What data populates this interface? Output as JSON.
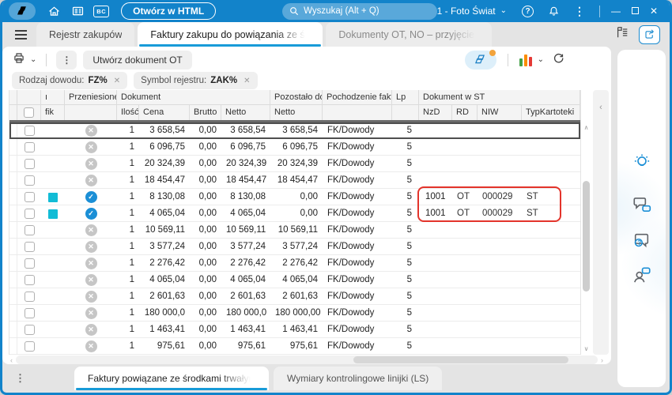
{
  "colors": {
    "titlebar": "#1283CA",
    "accent": "#189BD8",
    "transferred_blue": "#1B8FD6",
    "flag_teal": "#12BCD6",
    "annotation_red": "#E3342B"
  },
  "icons": {
    "bc_badge": "BC",
    "kebab": "⋮",
    "chevron_down": "⌄",
    "question": "?",
    "minimize": "—",
    "close": "✕",
    "check": "✓",
    "cross": "✕",
    "chip_close": "✕",
    "collapse_left": "‹",
    "scroll_left": "‹",
    "scroll_right": "›",
    "scroll_up": "∧",
    "scroll_down": "∨"
  },
  "titlebar": {
    "open_html_button": "Otwórz w HTML",
    "search_placeholder": "Wyszukaj (Alt + Q)",
    "company": "1 - Foto Świat"
  },
  "tabs": [
    {
      "label": "Rejestr zakupów",
      "active": false
    },
    {
      "label": "Faktury zakupu do powiązania ze środkami trwałymi",
      "active": true
    },
    {
      "label": "Dokumenty OT, NO – przyjęcie środka",
      "active": false
    }
  ],
  "toolbar": {
    "create_ot_button": "Utwórz dokument OT"
  },
  "filters": [
    {
      "name": "Rodzaj dowodu:",
      "value": "FZ%"
    },
    {
      "name": "Symbol rejestru:",
      "value": "ZAK%"
    }
  ],
  "table": {
    "header": {
      "clipped_line1": "ı",
      "clipped_line2": "fik",
      "przeniesione": "Przeniesione",
      "dokument": "Dokument",
      "ilosc": "Ilość",
      "cena": "Cena",
      "brutto": "Brutto",
      "netto": "Netto",
      "pozostalo": "Pozostało do",
      "pozostalo_netto": "Netto",
      "pochodzenie": "Pochodzenie faktur",
      "lp": "Lp",
      "dokument_st": "Dokument w ST",
      "nzd": "NzD",
      "rd": "RD",
      "niw": "NIW",
      "typ_kartoteki": "TypKartoteki"
    },
    "rows": [
      {
        "flag": false,
        "transferred": false,
        "ilosc": "1",
        "cena": "3 658,54",
        "brutto": "0,00",
        "netto": "3 658,54",
        "pozostalo_netto": "3 658,54",
        "pochodzenie": "FK/Dowody",
        "lp": "5",
        "nzd": "",
        "rd": "",
        "niw": "",
        "typ": ""
      },
      {
        "flag": false,
        "transferred": false,
        "ilosc": "1",
        "cena": "6 096,75",
        "brutto": "0,00",
        "netto": "6 096,75",
        "pozostalo_netto": "6 096,75",
        "pochodzenie": "FK/Dowody",
        "lp": "5",
        "nzd": "",
        "rd": "",
        "niw": "",
        "typ": ""
      },
      {
        "flag": false,
        "transferred": false,
        "ilosc": "1",
        "cena": "20 324,39",
        "brutto": "0,00",
        "netto": "20 324,39",
        "pozostalo_netto": "20 324,39",
        "pochodzenie": "FK/Dowody",
        "lp": "5",
        "nzd": "",
        "rd": "",
        "niw": "",
        "typ": ""
      },
      {
        "flag": false,
        "transferred": false,
        "ilosc": "1",
        "cena": "18 454,47",
        "brutto": "0,00",
        "netto": "18 454,47",
        "pozostalo_netto": "18 454,47",
        "pochodzenie": "FK/Dowody",
        "lp": "5",
        "nzd": "",
        "rd": "",
        "niw": "",
        "typ": ""
      },
      {
        "flag": true,
        "transferred": true,
        "ilosc": "1",
        "cena": "8 130,08",
        "brutto": "0,00",
        "netto": "8 130,08",
        "pozostalo_netto": "0,00",
        "pochodzenie": "FK/Dowody",
        "lp": "5",
        "nzd": "1001",
        "rd": "OT",
        "niw": "000029",
        "typ": "ST"
      },
      {
        "flag": true,
        "transferred": true,
        "ilosc": "1",
        "cena": "4 065,04",
        "brutto": "0,00",
        "netto": "4 065,04",
        "pozostalo_netto": "0,00",
        "pochodzenie": "FK/Dowody",
        "lp": "5",
        "nzd": "1001",
        "rd": "OT",
        "niw": "000029",
        "typ": "ST"
      },
      {
        "flag": false,
        "transferred": false,
        "ilosc": "1",
        "cena": "10 569,11",
        "brutto": "0,00",
        "netto": "10 569,11",
        "pozostalo_netto": "10 569,11",
        "pochodzenie": "FK/Dowody",
        "lp": "5",
        "nzd": "",
        "rd": "",
        "niw": "",
        "typ": ""
      },
      {
        "flag": false,
        "transferred": false,
        "ilosc": "1",
        "cena": "3 577,24",
        "brutto": "0,00",
        "netto": "3 577,24",
        "pozostalo_netto": "3 577,24",
        "pochodzenie": "FK/Dowody",
        "lp": "5",
        "nzd": "",
        "rd": "",
        "niw": "",
        "typ": ""
      },
      {
        "flag": false,
        "transferred": false,
        "ilosc": "1",
        "cena": "2 276,42",
        "brutto": "0,00",
        "netto": "2 276,42",
        "pozostalo_netto": "2 276,42",
        "pochodzenie": "FK/Dowody",
        "lp": "5",
        "nzd": "",
        "rd": "",
        "niw": "",
        "typ": ""
      },
      {
        "flag": false,
        "transferred": false,
        "ilosc": "1",
        "cena": "4 065,04",
        "brutto": "0,00",
        "netto": "4 065,04",
        "pozostalo_netto": "4 065,04",
        "pochodzenie": "FK/Dowody",
        "lp": "5",
        "nzd": "",
        "rd": "",
        "niw": "",
        "typ": ""
      },
      {
        "flag": false,
        "transferred": false,
        "ilosc": "1",
        "cena": "2 601,63",
        "brutto": "0,00",
        "netto": "2 601,63",
        "pozostalo_netto": "2 601,63",
        "pochodzenie": "FK/Dowody",
        "lp": "5",
        "nzd": "",
        "rd": "",
        "niw": "",
        "typ": ""
      },
      {
        "flag": false,
        "transferred": false,
        "ilosc": "1",
        "cena": "180 000,0",
        "brutto": "0,00",
        "netto": "180 000,0",
        "pozostalo_netto": "180 000,00",
        "pochodzenie": "FK/Dowody",
        "lp": "5",
        "nzd": "",
        "rd": "",
        "niw": "",
        "typ": ""
      },
      {
        "flag": false,
        "transferred": false,
        "ilosc": "1",
        "cena": "1 463,41",
        "brutto": "0,00",
        "netto": "1 463,41",
        "pozostalo_netto": "1 463,41",
        "pochodzenie": "FK/Dowody",
        "lp": "5",
        "nzd": "",
        "rd": "",
        "niw": "",
        "typ": ""
      },
      {
        "flag": false,
        "transferred": false,
        "ilosc": "1",
        "cena": "975,61",
        "brutto": "0,00",
        "netto": "975,61",
        "pozostalo_netto": "975,61",
        "pochodzenie": "FK/Dowody",
        "lp": "5",
        "nzd": "",
        "rd": "",
        "niw": "",
        "typ": ""
      }
    ]
  },
  "bottom_tabs": [
    {
      "label": "Faktury powiązane ze środkami trwałymi",
      "active": true
    },
    {
      "label": "Wymiary kontrolingowe linijki (LS)",
      "active": false
    }
  ]
}
